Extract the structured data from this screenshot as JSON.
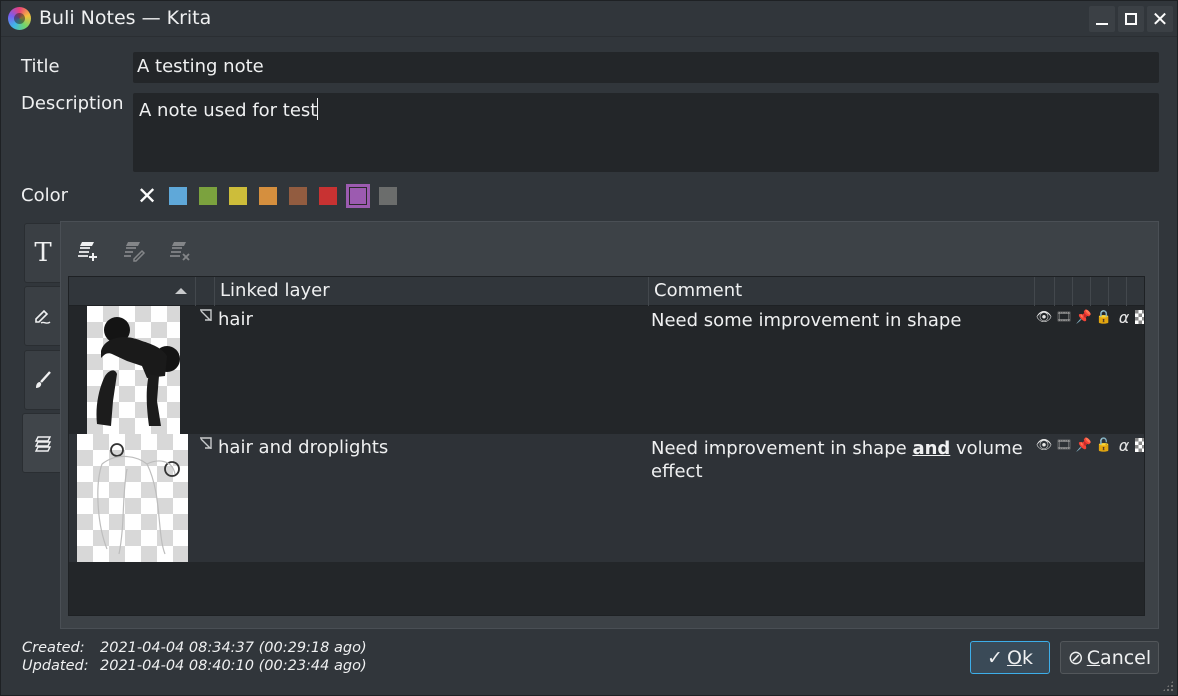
{
  "window": {
    "title": "Buli Notes — Krita",
    "controls": [
      "minimize",
      "maximize",
      "close"
    ]
  },
  "form": {
    "title_label": "Title",
    "title_value": "A testing note",
    "description_label": "Description",
    "description_value": "A note used for test",
    "color_label": "Color",
    "colors": [
      {
        "name": "none",
        "hex": null
      },
      {
        "name": "blue",
        "hex": "#5fa8d9"
      },
      {
        "name": "green",
        "hex": "#7ba23e"
      },
      {
        "name": "yellow",
        "hex": "#cdbd3a"
      },
      {
        "name": "orange",
        "hex": "#d58f3e"
      },
      {
        "name": "brown",
        "hex": "#925c40"
      },
      {
        "name": "red",
        "hex": "#c83232"
      },
      {
        "name": "purple",
        "hex": "#9c5bb0",
        "selected": true
      },
      {
        "name": "gray",
        "hex": "#6b6d6c"
      }
    ]
  },
  "side_tabs": [
    {
      "name": "text",
      "icon": "text-icon"
    },
    {
      "name": "draw",
      "icon": "pencil-signature-icon"
    },
    {
      "name": "brush",
      "icon": "brush-icon"
    },
    {
      "name": "layers",
      "icon": "layers-icon",
      "active": true
    }
  ],
  "toolbar": {
    "buttons": [
      {
        "name": "add-layer-link",
        "enabled": true
      },
      {
        "name": "edit-layer-link",
        "enabled": false
      },
      {
        "name": "remove-layer-link",
        "enabled": false
      }
    ]
  },
  "table": {
    "columns": [
      "",
      "",
      "Linked layer",
      "Comment"
    ],
    "rows": [
      {
        "layer": "hair",
        "comment_parts": [
          "Need some improvement in shape"
        ],
        "properties": {
          "visible": true,
          "animated": true,
          "pinned": true,
          "locked": true,
          "alpha_locked": true,
          "inherit_alpha": true
        }
      },
      {
        "layer": "hair and droplights",
        "comment_before": "Need improvement in shape ",
        "comment_bold": "and",
        "comment_after": " volume effect",
        "properties": {
          "visible": true,
          "animated": true,
          "pinned": true,
          "locked": false,
          "alpha_locked": true,
          "inherit_alpha": true
        }
      }
    ]
  },
  "footer": {
    "created_label": "Created:",
    "created_value": "2021-04-04 08:34:37 (00:29:18 ago)",
    "updated_label": "Updated:",
    "updated_value": "2021-04-04 08:40:10 (00:23:44 ago)",
    "ok_label_underlined": "O",
    "ok_label_rest": "k",
    "cancel_label_underlined": "C",
    "cancel_label_rest": "ancel"
  },
  "accent_color": "#3daee9"
}
